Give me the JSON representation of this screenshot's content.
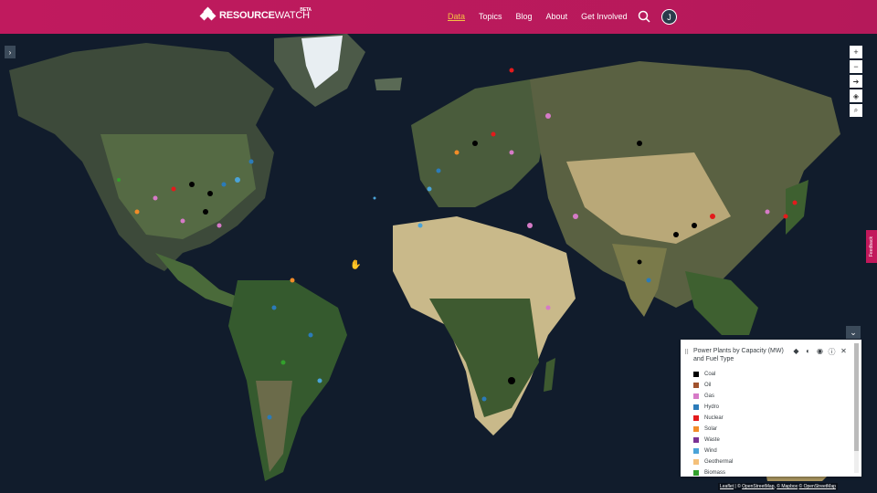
{
  "header": {
    "logo_text": "RESOURCE",
    "logo_text2": "WATCH",
    "beta": "BETA",
    "nav": [
      "Data",
      "Topics",
      "Blog",
      "About",
      "Get Involved"
    ],
    "avatar_initial": "J"
  },
  "map": {
    "feedback_label": "Feedback",
    "legend": {
      "title": "Power Plants by Capacity (MW) and Fuel Type",
      "items": [
        {
          "label": "Coal",
          "color": "#000000"
        },
        {
          "label": "Oil",
          "color": "#a0522d"
        },
        {
          "label": "Gas",
          "color": "#d67ac7"
        },
        {
          "label": "Hydro",
          "color": "#2b7bb9"
        },
        {
          "label": "Nuclear",
          "color": "#e31a1c"
        },
        {
          "label": "Solar",
          "color": "#f28c28"
        },
        {
          "label": "Waste",
          "color": "#7b3294"
        },
        {
          "label": "Wind",
          "color": "#4aa3d8"
        },
        {
          "label": "Geothermal",
          "color": "#f4c07a"
        },
        {
          "label": "Biomass",
          "color": "#33a02c"
        }
      ]
    },
    "attribution": {
      "leaflet": "Leaflet",
      "sep": " | © ",
      "osm": "OpenStreetMap",
      "mapbox": "© Mapbox",
      "osm2": "© OpenStreetMap"
    }
  }
}
